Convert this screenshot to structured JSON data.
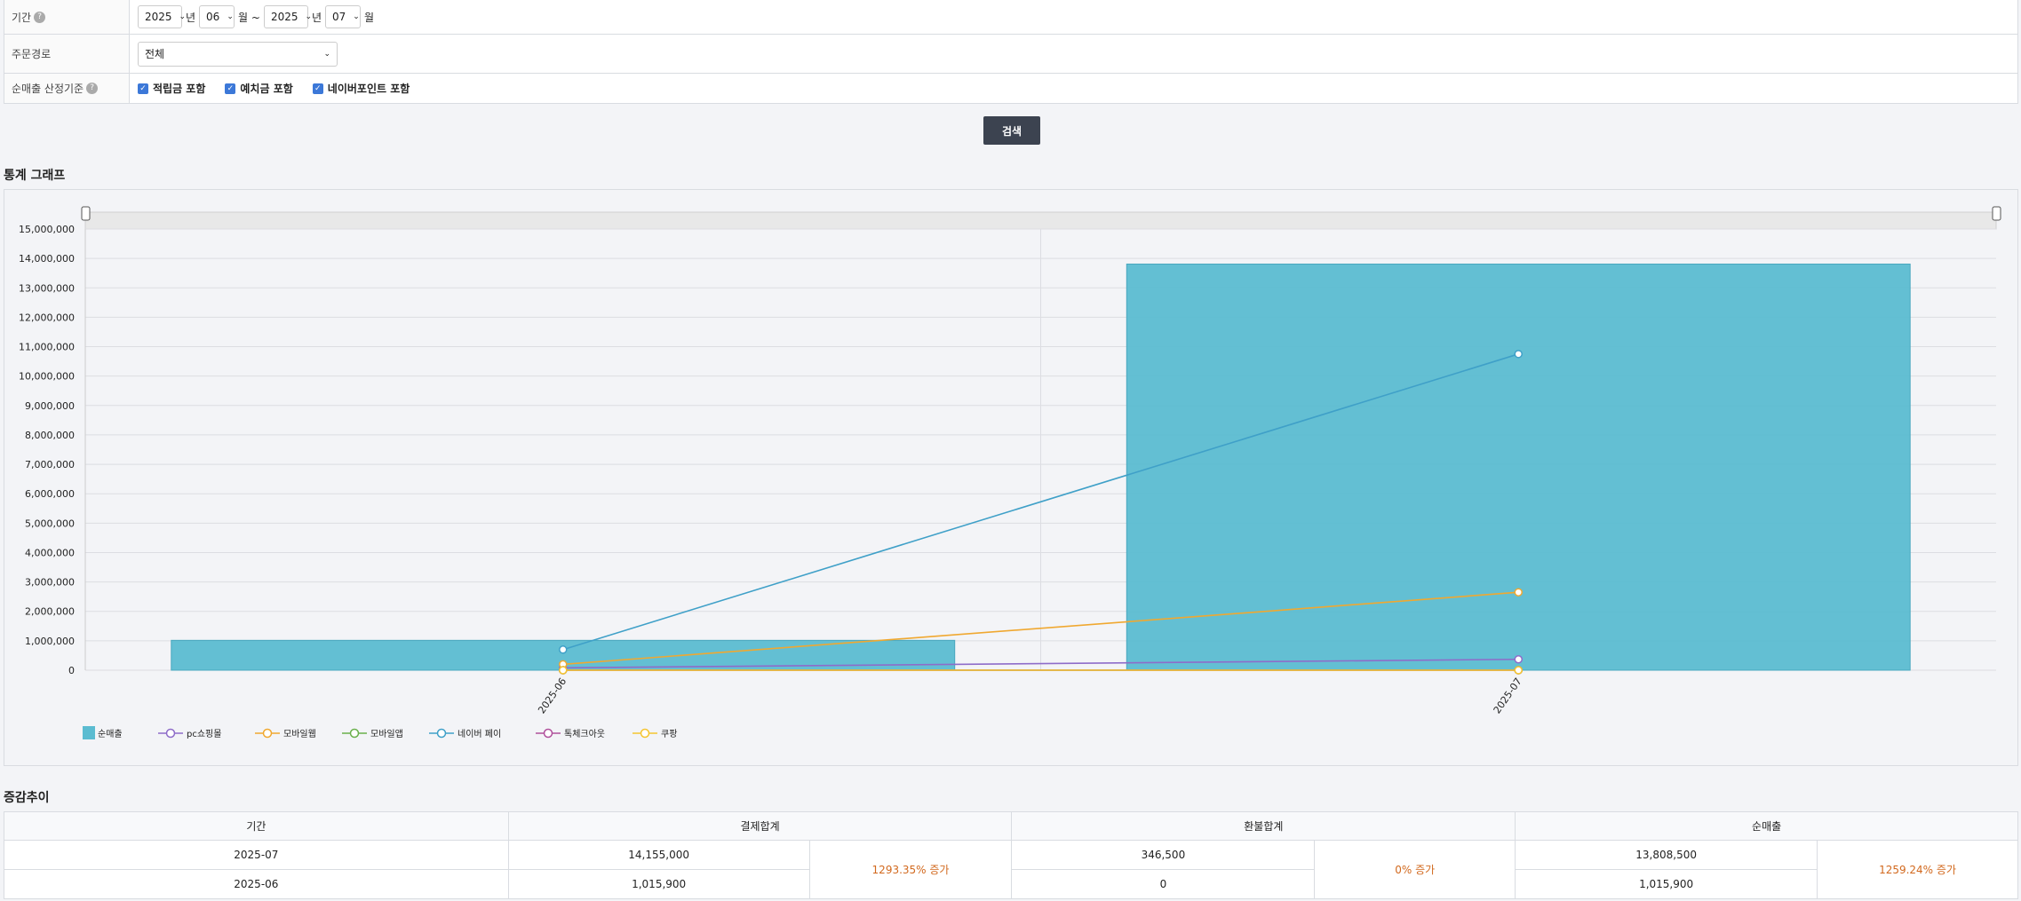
{
  "filter": {
    "period_label": "기간",
    "from_year": "2025",
    "year_unit": "년",
    "from_month": "06",
    "month_unit_tilde": "월 ~",
    "to_year": "2025",
    "to_month": "07",
    "month_unit": "월",
    "channel_label": "주문경로",
    "channel_value": "전체",
    "criteria_label": "순매출 산정기준",
    "checkboxes": [
      "적립금 포함",
      "예치금 포함",
      "네이버포인트 포함"
    ],
    "search_button": "검색"
  },
  "chart_title": "통계 그래프",
  "chart_data": {
    "type": "bar+line",
    "categories": [
      "2025-06",
      "2025-07"
    ],
    "ylim": [
      0,
      15000000
    ],
    "yticks": [
      "0",
      "1,000,000",
      "2,000,000",
      "3,000,000",
      "4,000,000",
      "5,000,000",
      "6,000,000",
      "7,000,000",
      "8,000,000",
      "9,000,000",
      "10,000,000",
      "11,000,000",
      "12,000,000",
      "13,000,000",
      "14,000,000",
      "15,000,000"
    ],
    "bar_series": {
      "name": "순매출",
      "values": [
        1015900,
        13808500
      ],
      "color": "#5bbcd1"
    },
    "line_series": [
      {
        "name": "pc쇼핑몰",
        "values": [
          80000,
          370000
        ],
        "color": "#8e6cc9"
      },
      {
        "name": "모바일웹",
        "values": [
          200000,
          2650000
        ],
        "color": "#f0a830"
      },
      {
        "name": "모바일앱",
        "values": [
          0,
          0
        ],
        "color": "#6ab04c"
      },
      {
        "name": "네이버 페이",
        "values": [
          700000,
          10750000
        ],
        "color": "#3fa0c8"
      },
      {
        "name": "톡체크아웃",
        "values": [
          0,
          0
        ],
        "color": "#b0509c"
      },
      {
        "name": "쿠팡",
        "values": [
          0,
          0
        ],
        "color": "#f5c530"
      }
    ],
    "legend": "bottom-left"
  },
  "table_title": "증감추이",
  "table": {
    "headers": [
      "기간",
      "결제합계",
      "환불합계",
      "순매출"
    ],
    "rows": [
      {
        "period": "2025-07",
        "payment": "14,155,000",
        "refund": "346,500",
        "net": "13,808,500"
      },
      {
        "period": "2025-06",
        "payment": "1,015,900",
        "refund": "0",
        "net": "1,015,900"
      }
    ],
    "payment_change": "1293.35% 증가",
    "refund_change": "0% 증가",
    "net_change": "1259.24% 증가"
  }
}
